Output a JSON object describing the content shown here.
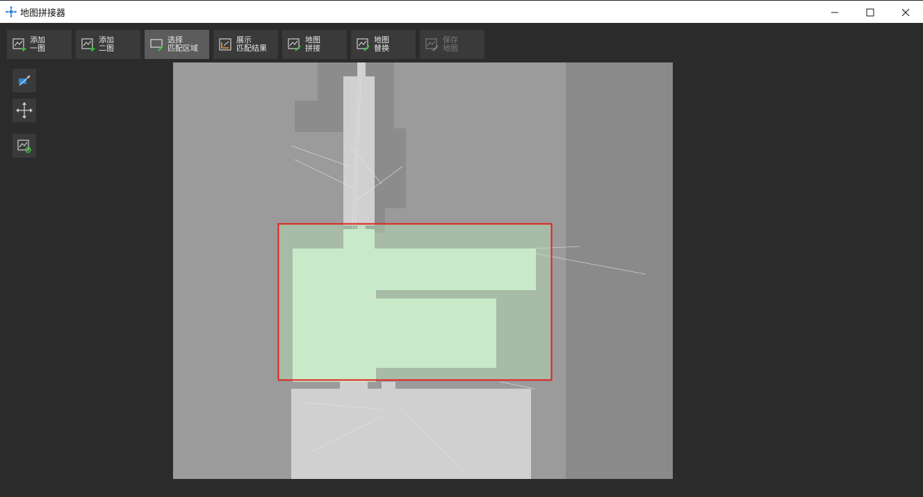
{
  "window": {
    "title": "地图拼接器"
  },
  "toolbar": {
    "buttons": [
      {
        "line1": "添加",
        "line2": "一图",
        "icon": "add-map-icon",
        "state": "normal"
      },
      {
        "line1": "添加",
        "line2": "二图",
        "icon": "add-map-icon",
        "state": "normal"
      },
      {
        "line1": "选择",
        "line2": "匹配区域",
        "icon": "select-region-icon",
        "state": "active"
      },
      {
        "line1": "展示",
        "line2": "匹配结果",
        "icon": "show-result-icon",
        "state": "normal"
      },
      {
        "line1": "地图",
        "line2": "拼接",
        "icon": "stitch-map-icon",
        "state": "normal"
      },
      {
        "line1": "地图",
        "line2": "替换",
        "icon": "replace-map-icon",
        "state": "normal"
      },
      {
        "line1": "保存",
        "line2": "地图",
        "icon": "save-map-icon",
        "state": "disabled"
      }
    ]
  },
  "side_tools": [
    {
      "icon": "measure-line-icon"
    },
    {
      "icon": "move-pan-icon"
    },
    {
      "icon": "refresh-map-icon"
    }
  ],
  "colors": {
    "background": "#2b2b2b",
    "button": "#3a3a3a",
    "button_active": "#5c5c5c",
    "map_unknown": "#9b9b9b",
    "map_free": "#d0d0d0",
    "selection_stroke": "#e0201c",
    "selection_fill": "#b8e6b8",
    "icon_accent_green": "#3ec13e",
    "icon_accent_blue": "#2a86d8"
  }
}
